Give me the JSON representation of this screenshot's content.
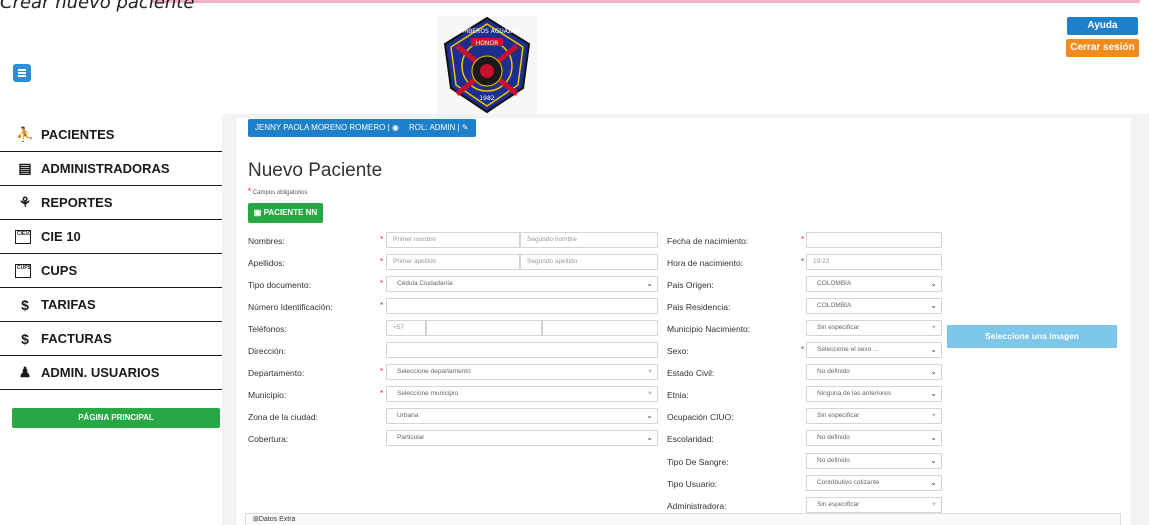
{
  "caption": "Crear nuevo paciente",
  "header": {
    "help_label": "Ayuda",
    "logout_label": "Cerrar sesión",
    "logo": {
      "ring_text": "BOMBEROS AGUAZUL",
      "banner": "HONOR",
      "year": "1982",
      "colors": {
        "ring": "#1c2f8f",
        "shield": "#1a1a1a",
        "accent": "#f2c200",
        "red": "#c8102e"
      }
    }
  },
  "sidebar": {
    "items": [
      {
        "label": "PACIENTES",
        "icon": "patients-icon"
      },
      {
        "label": "ADMINISTRADORAS",
        "icon": "building-icon"
      },
      {
        "label": "REPORTES",
        "icon": "reports-icon"
      },
      {
        "label": "CIE 10",
        "icon": "cie10-icon"
      },
      {
        "label": "CUPS",
        "icon": "cups-icon"
      },
      {
        "label": "TARIFAS",
        "icon": "dollar-icon"
      },
      {
        "label": "FACTURAS",
        "icon": "dollar-icon"
      },
      {
        "label": "ADMIN. USUARIOS",
        "icon": "users-icon"
      }
    ],
    "main_page_label": "PÁGINA PRINCIPAL",
    "cie_icon_text": "CIE10",
    "cups_icon_text": "CUPS"
  },
  "user_bar": {
    "user_label": "JENNY PAOLA MORENO ROMERO |",
    "role_label": "ROL: ADMIN |"
  },
  "form": {
    "title": "Nuevo Paciente",
    "required_note": "Campos obligatorios",
    "nn_button": "PACIENTE NN",
    "left": {
      "nombres": {
        "label": "Nombres:",
        "ph1": "Primer nombre",
        "ph2": "Segundo nombre"
      },
      "apellidos": {
        "label": "Apellidos:",
        "ph1": "Primer apellido",
        "ph2": "Segundo apellido"
      },
      "tipo_doc": {
        "label": "Tipo documento:",
        "value": "Cédula Ciudadanía"
      },
      "num_id": {
        "label": "Número Identificación:",
        "value": ""
      },
      "telefonos": {
        "label": "Teléfonos:",
        "prefix": "+57"
      },
      "direccion": {
        "label": "Dirección:",
        "value": ""
      },
      "departamento": {
        "label": "Departamento:",
        "value": "Seleccione departamento"
      },
      "municipio": {
        "label": "Municipio:",
        "value": "Seleccione municipio"
      },
      "zona": {
        "label": "Zona de la ciudad:",
        "value": "Urbana"
      },
      "cobertura": {
        "label": "Cobertura:",
        "value": "Particular"
      }
    },
    "right": {
      "fecha_nac": {
        "label": "Fecha de nacimiento:",
        "value": ""
      },
      "hora_nac": {
        "label": "Hora de nacimiento:",
        "value": "19:23"
      },
      "pais_origen": {
        "label": "Pais Origen:",
        "value": "COLOMBIA"
      },
      "pais_res": {
        "label": "Pais Residencia:",
        "value": "COLOMBIA"
      },
      "mun_nac": {
        "label": "Municipio Nacimiento:",
        "value": "Sin especificar"
      },
      "sexo": {
        "label": "Sexo:",
        "value": "Seleccione el sexo ..."
      },
      "estado_civil": {
        "label": "Estado Civil:",
        "value": "No definido"
      },
      "etnia": {
        "label": "Etnia:",
        "value": "Ninguna de las anteriores"
      },
      "ocupacion": {
        "label": "Ocupación CIUO:",
        "value": "Sin especificar"
      },
      "escolaridad": {
        "label": "Escolaridad:",
        "value": "No definido"
      },
      "sangre": {
        "label": "Tipo De Sangre:",
        "value": "No definido"
      },
      "tipo_usuario": {
        "label": "Tipo Usuario:",
        "value": "Contributivo cotizante"
      },
      "administradora": {
        "label": "Administradora:",
        "value": "Sin especificar"
      }
    },
    "image_button": "Seleccione una imagen",
    "extra_label": "Datos Extra"
  },
  "colors": {
    "primary": "#1e7fcb",
    "success": "#28a745",
    "warning": "#f28a1c",
    "image_button": "#7cc7ea",
    "required": "#e02020"
  }
}
